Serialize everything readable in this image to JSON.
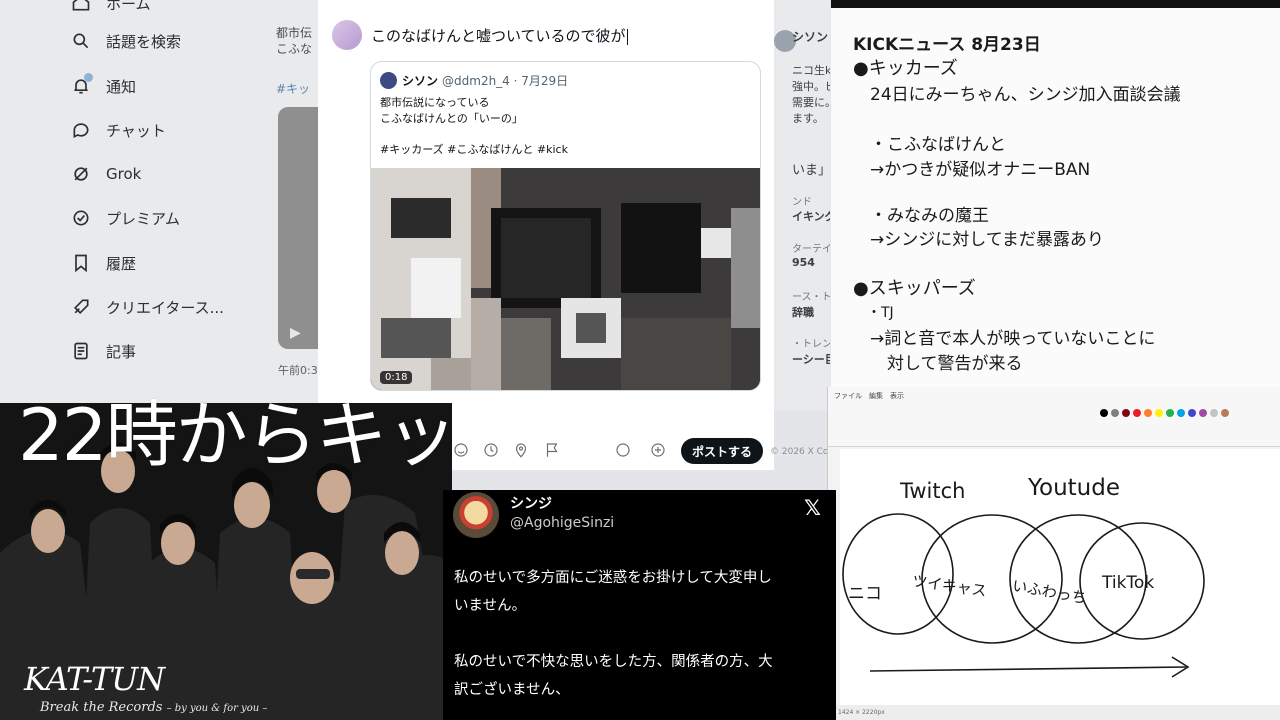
{
  "sidebar": {
    "items": [
      {
        "label": "ホーム",
        "icon": "home-icon"
      },
      {
        "label": "話題を検索",
        "icon": "search-icon"
      },
      {
        "label": "通知",
        "icon": "bell-icon"
      },
      {
        "label": "チャット",
        "icon": "chat-icon"
      },
      {
        "label": "Grok",
        "icon": "grok-icon"
      },
      {
        "label": "プレミアム",
        "icon": "verified-icon"
      },
      {
        "label": "履歴",
        "icon": "bookmark-icon"
      },
      {
        "label": "クリエイタース...",
        "icon": "rocket-icon"
      },
      {
        "label": "記事",
        "icon": "article-icon"
      }
    ]
  },
  "background_feed": {
    "left_lines": [
      "都市伝",
      "こふな",
      "#キッ"
    ],
    "left_time": "午前0:32",
    "right_name": "シソン",
    "right_lines": [
      "ニコ生k",
      "強中。ビ",
      "需要に。",
      "ます。",
      "いま」を",
      "ンド",
      "イキングタ",
      "ターテイン",
      "954",
      "ース・トレン",
      "辞職",
      "・トレンド",
      "ーシー巨"
    ]
  },
  "compose": {
    "draft_text": "このなばけんと嘘ついているので彼が",
    "quote": {
      "name": "シソン",
      "handle": "@ddm2h_4 · 7月29日",
      "lines": [
        "都市伝説になっている",
        "こふなばけんとの「いーの」",
        "",
        "#キッカーズ #こふなばけんと #kick"
      ],
      "duration": "0:18"
    },
    "post_label": "ポストする",
    "copyright": "© 2026 X Corp."
  },
  "news": {
    "title": "KICKニュース 8月23日",
    "lines": [
      "●キッカーズ",
      "　24日にみーちゃん、シンジ加入面談会議",
      "",
      "　・こふなばけんと",
      "　→かつきが疑似オナニーBAN",
      "",
      "　・みなみの魔王",
      "　→シンジに対してまだ暴露あり",
      "",
      "●スキッパーズ",
      "　・TJ",
      "　→詞と音で本人が映っていないことに",
      "　　対して警告が来る"
    ]
  },
  "paint": {
    "menu": "ファイル　編集　表示",
    "canvas_words": {
      "twitch": "Twitch",
      "youtube": "Youtude",
      "niconico": "ニコ",
      "twitcasting": "ツイキャス",
      "hwa": "いふわっち",
      "tiktok": "TikTok"
    },
    "status": "1424 × 2220px",
    "colors": [
      "#000000",
      "#7f7f7f",
      "#880015",
      "#ed1c24",
      "#ff7f27",
      "#fff200",
      "#22b14c",
      "#00a2e8",
      "#3f48cc",
      "#a349a4",
      "#c3c3c3",
      "#b97a57"
    ]
  },
  "photo": {
    "brand": "KAT-TUN",
    "subtitle_main": "Break the Records",
    "subtitle_tail": "– by you & for you –"
  },
  "statement": {
    "name": "シンジ",
    "handle": "@AgohigeSinzi",
    "x_logo": "𝕏",
    "lines": [
      "私のせいで多方面にご迷惑をお掛けして大変申し",
      "いません。",
      "",
      "私のせいで不快な思いをした方、関係者の方、大",
      "訳ございません、"
    ]
  },
  "overlay": {
    "text": "22時からキッ"
  }
}
